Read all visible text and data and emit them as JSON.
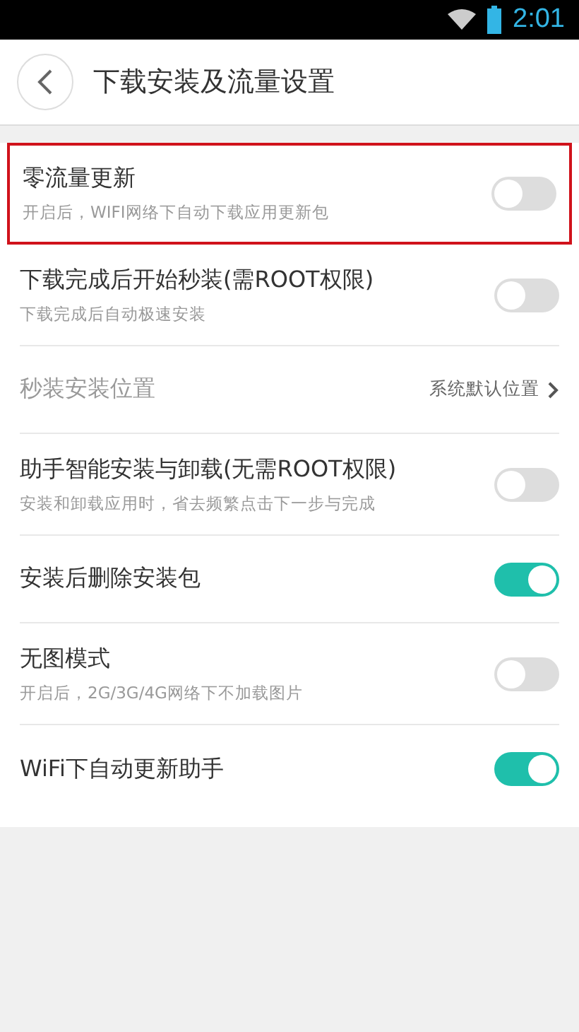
{
  "status_bar": {
    "time": "2:01"
  },
  "header": {
    "title": "下载安装及流量设置"
  },
  "settings": [
    {
      "kind": "toggle",
      "title": "零流量更新",
      "subtitle": "开启后，WIFI网络下自动下载应用更新包",
      "on": false,
      "highlighted": true,
      "disabled": false
    },
    {
      "kind": "toggle",
      "title": "下载完成后开始秒装(需ROOT权限)",
      "subtitle": "下载完成后自动极速安装",
      "on": false,
      "highlighted": false,
      "disabled": false
    },
    {
      "kind": "link",
      "title": "秒装安装位置",
      "value": "系统默认位置",
      "highlighted": false,
      "disabled": true
    },
    {
      "kind": "toggle",
      "title": "助手智能安装与卸载(无需ROOT权限)",
      "subtitle": "安装和卸载应用时，省去频繁点击下一步与完成",
      "on": false,
      "highlighted": false,
      "disabled": false
    },
    {
      "kind": "toggle",
      "title": "安装后删除安装包",
      "on": true,
      "highlighted": false,
      "disabled": false
    },
    {
      "kind": "toggle",
      "title": "无图模式",
      "subtitle": "开启后，2G/3G/4G网络下不加载图片",
      "on": false,
      "highlighted": false,
      "disabled": false
    },
    {
      "kind": "toggle",
      "title": "WiFi下自动更新助手",
      "on": true,
      "highlighted": false,
      "disabled": false
    }
  ]
}
